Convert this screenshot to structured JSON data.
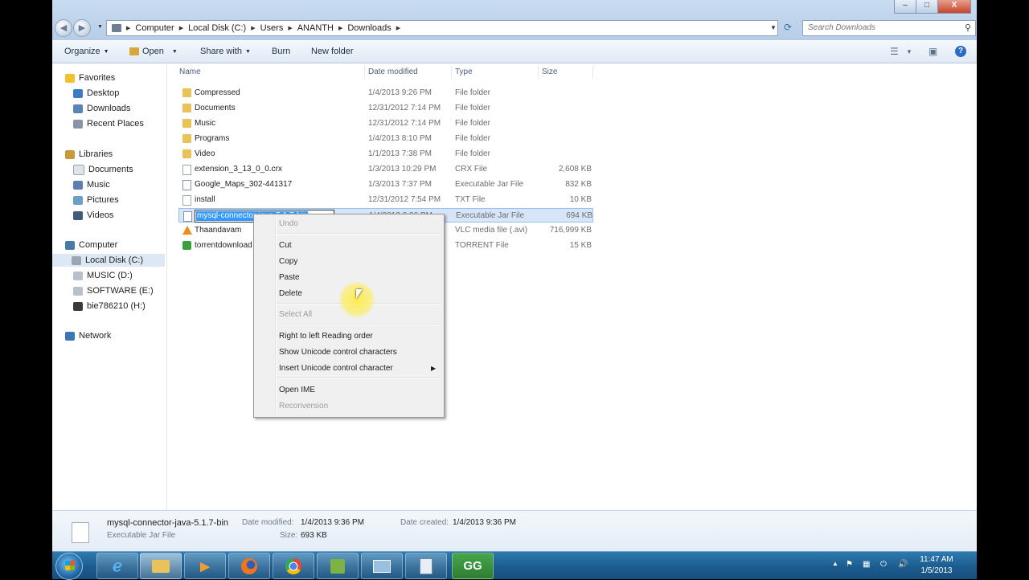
{
  "address": {
    "breadcrumbs": [
      "Computer",
      "Local Disk (C:)",
      "Users",
      "ANANTH",
      "Downloads"
    ]
  },
  "search": {
    "placeholder": "Search Downloads"
  },
  "window_controls": {
    "minimize": "–",
    "maximize": "□",
    "close": "X"
  },
  "toolbar": {
    "organize": "Organize",
    "open": "Open",
    "share_with": "Share with",
    "burn": "Burn",
    "new_folder": "New folder"
  },
  "nav": {
    "favorites": "Favorites",
    "desktop": "Desktop",
    "downloads": "Downloads",
    "recent_places": "Recent Places",
    "libraries": "Libraries",
    "documents": "Documents",
    "music": "Music",
    "pictures": "Pictures",
    "videos": "Videos",
    "computer": "Computer",
    "local_disk_c": "Local Disk (C:)",
    "music_d": "MUSIC (D:)",
    "software_e": "SOFTWARE (E:)",
    "drive_h": "bie786210 (H:)",
    "network": "Network"
  },
  "columns": {
    "name": "Name",
    "date": "Date modified",
    "type": "Type",
    "size": "Size"
  },
  "files": [
    {
      "name": "Compressed",
      "date": "1/4/2013 9:26 PM",
      "type": "File folder",
      "size": ""
    },
    {
      "name": "Documents",
      "date": "12/31/2012 7:14 PM",
      "type": "File folder",
      "size": ""
    },
    {
      "name": "Music",
      "date": "12/31/2012 7:14 PM",
      "type": "File folder",
      "size": ""
    },
    {
      "name": "Programs",
      "date": "1/4/2013 8:10 PM",
      "type": "File folder",
      "size": ""
    },
    {
      "name": "Video",
      "date": "1/1/2013 7:38 PM",
      "type": "File folder",
      "size": ""
    },
    {
      "name": "extension_3_13_0_0.crx",
      "date": "1/3/2013 10:29 PM",
      "type": "CRX File",
      "size": "2,608 KB"
    },
    {
      "name": "Google_Maps_302-441317",
      "date": "1/3/2013 7:37 PM",
      "type": "Executable Jar File",
      "size": "832 KB"
    },
    {
      "name": "install",
      "date": "12/31/2012 7:54 PM",
      "type": "TXT File",
      "size": "10 KB"
    },
    {
      "name": "mysql-connector-java-5.1.7-bin",
      "date": "1/4/2013 9:36 PM",
      "type": "Executable Jar File",
      "size": "694 KB"
    },
    {
      "name": "Thaandavam",
      "date": "",
      "type": "VLC media file (.avi)",
      "size": "716,999 KB"
    },
    {
      "name": "torrentdownload",
      "date": "",
      "type": "TORRENT File",
      "size": "15 KB"
    }
  ],
  "rename_text": "mysql-connector-java-5.1.7-bin",
  "context_menu": {
    "undo": "Undo",
    "cut": "Cut",
    "copy": "Copy",
    "paste": "Paste",
    "delete": "Delete",
    "select_all": "Select All",
    "rtl": "Right to left Reading order",
    "show_unicode": "Show Unicode control characters",
    "insert_unicode": "Insert Unicode control character",
    "open_ime": "Open IME",
    "reconversion": "Reconversion"
  },
  "details": {
    "name": "mysql-connector-java-5.1.7-bin",
    "type": "Executable Jar File",
    "date_modified_label": "Date modified:",
    "date_modified": "1/4/2013 9:36 PM",
    "size_label": "Size:",
    "size": "693 KB",
    "date_created_label": "Date created:",
    "date_created": "1/4/2013 9:36 PM"
  },
  "taskbar": {
    "gg_label": "GG"
  },
  "clock": {
    "time": "11:47 AM",
    "date": "1/5/2013"
  }
}
